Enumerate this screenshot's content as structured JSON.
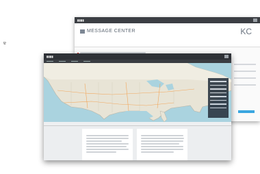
{
  "stray_char": "ɐ",
  "back_window": {
    "title": "MESSAGE CENTER",
    "initials": "KC"
  },
  "front_window": {
    "map_view": "map of North America",
    "panes": [
      "",
      ""
    ]
  }
}
